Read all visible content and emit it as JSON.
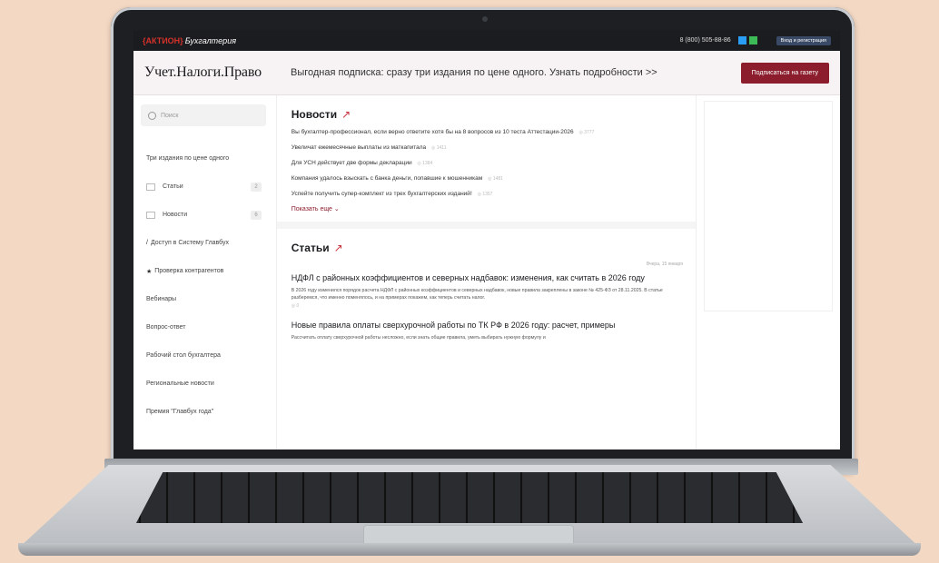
{
  "topbar": {
    "brand_aktion": "{АКТИОН}",
    "brand_product": "Бухгалтерия",
    "phone": "8 (800) 505-88-86",
    "login": "Вход и регистрация"
  },
  "header": {
    "logo": "Учет.Налоги.Право",
    "promo": "Выгодная подписка: сразу три издания по цене одного. Узнать подробности >>",
    "subscribe": "Подписаться на газету"
  },
  "sidebar": {
    "search_placeholder": "Поиск",
    "items": [
      {
        "label": "Три издания по цене одного"
      },
      {
        "label": "Статьи",
        "count": "2"
      },
      {
        "label": "Новости",
        "count": "6"
      },
      {
        "label": "Доступ в Систему Главбух"
      },
      {
        "label": "Проверка контрагентов"
      },
      {
        "label": "Вебинары"
      },
      {
        "label": "Вопрос-ответ"
      },
      {
        "label": "Рабочий стол бухгалтера"
      },
      {
        "label": "Региональные новости"
      },
      {
        "label": "Премия \"Главбух года\""
      }
    ]
  },
  "news": {
    "title": "Новости",
    "items": [
      {
        "text": "Вы бухгалтер-профессионал, если верно ответите хотя бы на 8 вопросов из 10 теста Аттестации-2026",
        "views": "3777"
      },
      {
        "text": "Увеличат ежемесячные выплаты из маткапитала",
        "views": "1411"
      },
      {
        "text": "Для УСН действует две формы декларации",
        "views": "1384"
      },
      {
        "text": "Компания удалось взыскать с банка деньги, попавшие к мошенникам",
        "views": "1481"
      },
      {
        "text": "Успейте получить супер-комплект из трех бухгалтерских изданий!",
        "views": "1357"
      }
    ],
    "more": "Показать еще"
  },
  "articles": {
    "title": "Статьи",
    "date": "Вчера, 15 января",
    "items": [
      {
        "title": "НДФЛ с районных коэффициентов и северных надбавок: изменения, как считать в 2026 году",
        "text": "В 2026 году изменился порядок расчета НДФЛ с районных коэффициентов и северных надбавок, новые правила закреплены в законе № 425-ФЗ от 28.11.2025. В статье разберемся, что именно поменялось, и на примерах покажем, как теперь считать налог.",
        "views": "0"
      },
      {
        "title": "Новые правила оплаты сверхурочной работы по ТК РФ в 2026 году: расчет, примеры",
        "text": "Рассчитать оплату сверхурочной работы несложно, если знать общие правила, уметь выбирать нужную формулу и",
        "views": ""
      }
    ]
  },
  "colors": {
    "brand_red": "#d6322c",
    "accent_maroon": "#8b1d2c",
    "telegram": "#2a9df4",
    "whatsapp": "#3dbb57"
  }
}
